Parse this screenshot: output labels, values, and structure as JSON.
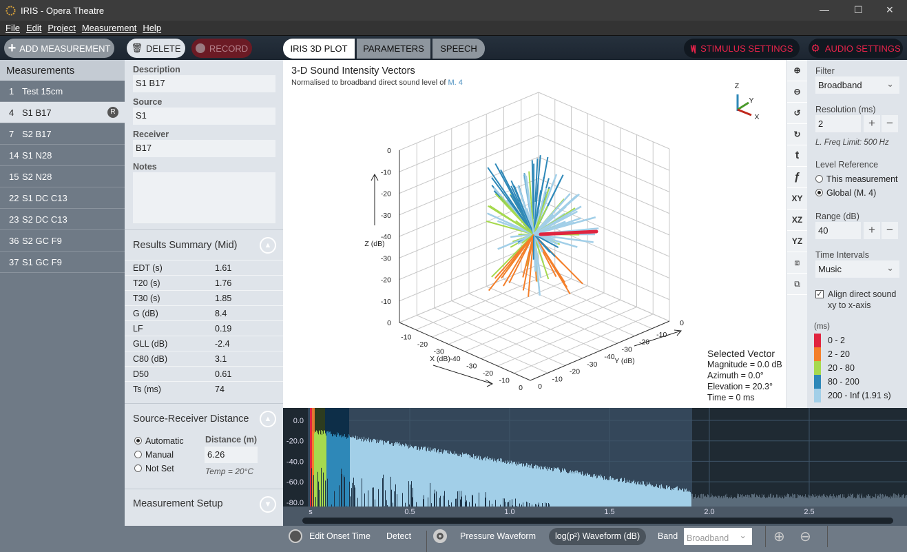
{
  "window": {
    "title": "IRIS - Opera Theatre",
    "minimize": "—",
    "maximize": "☐",
    "close": "✕"
  },
  "menu": [
    "File",
    "Edit",
    "Project",
    "Measurement",
    "Help"
  ],
  "toolbar": {
    "add": "ADD MEASUREMENT",
    "delete": "DELETE",
    "record": "RECORD",
    "tabs": [
      "IRIS 3D PLOT",
      "PARAMETERS",
      "SPEECH"
    ],
    "stimulus": "STIMULUS SETTINGS",
    "audio": "AUDIO SETTINGS",
    "accent": "#e8234a"
  },
  "sidebar": {
    "title": "Measurements",
    "items": [
      {
        "num": "1",
        "name": "Test 15cm"
      },
      {
        "num": "4",
        "name": "S1 B17",
        "badge": "R",
        "selected": true
      },
      {
        "num": "7",
        "name": "S2 B17"
      },
      {
        "num": "14",
        "name": "S1 N28"
      },
      {
        "num": "15",
        "name": "S2 N28"
      },
      {
        "num": "22",
        "name": "S1 DC C13"
      },
      {
        "num": "23",
        "name": "S2 DC C13"
      },
      {
        "num": "36",
        "name": "S2 GC F9"
      },
      {
        "num": "37",
        "name": "S1 GC F9"
      }
    ]
  },
  "details": {
    "description_label": "Description",
    "description": "S1 B17",
    "source_label": "Source",
    "source": "S1",
    "receiver_label": "Receiver",
    "receiver": "B17",
    "notes_label": "Notes",
    "notes": ""
  },
  "results": {
    "title": "Results Summary (Mid)",
    "rows": [
      {
        "k": "EDT (s)",
        "v": "1.61"
      },
      {
        "k": "T20 (s)",
        "v": "1.76"
      },
      {
        "k": "T30 (s)",
        "v": "1.85"
      },
      {
        "k": "G (dB)",
        "v": "8.4"
      },
      {
        "k": "LF",
        "v": "0.19"
      },
      {
        "k": "GLL (dB)",
        "v": "-2.4"
      },
      {
        "k": "C80 (dB)",
        "v": "3.1"
      },
      {
        "k": "D50",
        "v": "0.61"
      },
      {
        "k": "Ts (ms)",
        "v": "74"
      }
    ]
  },
  "distance": {
    "title": "Source-Receiver Distance",
    "options": [
      "Automatic",
      "Manual",
      "Not Set"
    ],
    "selected": "Automatic",
    "label": "Distance (m)",
    "value": "6.26",
    "temp": "Temp = 20°C"
  },
  "setup": {
    "title": "Measurement Setup"
  },
  "plot": {
    "title": "3-D Sound Intensity Vectors",
    "subtitle_prefix": "Normalised to broadband direct sound level of ",
    "subtitle_ref": "M. 4",
    "z_label": "Z (dB)",
    "x_label": "X (dB)",
    "y_label": "Y (dB)",
    "z_ticks": [
      "0",
      "-10",
      "-20",
      "-30",
      "-40",
      "-30",
      "-20",
      "-10",
      "0"
    ],
    "x_ticks": [
      "-10",
      "-20",
      "-30",
      "-40",
      "-30",
      "-20",
      "-10",
      "0"
    ],
    "y_ticks": [
      "0",
      "-10",
      "-20",
      "-30",
      "-40",
      "-30",
      "-20",
      "-10",
      "0"
    ],
    "gizmo": {
      "z": "Z",
      "y": "Y",
      "x": "X"
    },
    "selected": {
      "title": "Selected Vector",
      "magnitude": "Magnitude = 0.0 dB",
      "azimuth": "Azimuth = 0.0°",
      "elevation": "Elevation = 20.3°",
      "time": "Time = 0 ms"
    }
  },
  "tools": [
    "zoom-in",
    "zoom-out",
    "rotate-z-ccw",
    "rotate-z-cw",
    "tilt-up",
    "tilt-down",
    "XY",
    "XZ",
    "YZ",
    "cube-view-1",
    "cube-view-2"
  ],
  "settings": {
    "filter_label": "Filter",
    "filter": "Broadband",
    "resolution_label": "Resolution (ms)",
    "resolution": "2",
    "freq_limit": "L. Freq Limit: 500 Hz",
    "level_label": "Level Reference",
    "level_options": [
      "This measurement",
      "Global (M. 4)"
    ],
    "level_selected": "Global (M. 4)",
    "range_label": "Range (dB)",
    "range": "40",
    "intervals_label": "Time Intervals",
    "intervals": "Music",
    "align_label": "Align direct sound xy to x-axis",
    "align_checked": true,
    "legend_unit": "(ms)",
    "legend": [
      {
        "label": "0 - 2",
        "color": "#e0243f"
      },
      {
        "label": "2 - 20",
        "color": "#f47f2a"
      },
      {
        "label": "20 - 80",
        "color": "#a6d94e"
      },
      {
        "label": "80 - 200",
        "color": "#2e88b8"
      },
      {
        "label": "200 - Inf (1.91 s)",
        "color": "#a2cfe8"
      }
    ]
  },
  "waveform": {
    "y_ticks": [
      "0.0",
      "-20.0",
      "-40.0",
      "-60.0",
      "-80.0"
    ],
    "x_ticks": [
      "s",
      "0.5",
      "1.0",
      "1.5",
      "2.0",
      "2.5"
    ]
  },
  "bottom": {
    "onset": "Edit Onset Time",
    "detect": "Detect",
    "pressure": "Pressure Waveform",
    "log": "log(p²) Waveform (dB)",
    "band_label": "Band",
    "band": "Broadband"
  }
}
